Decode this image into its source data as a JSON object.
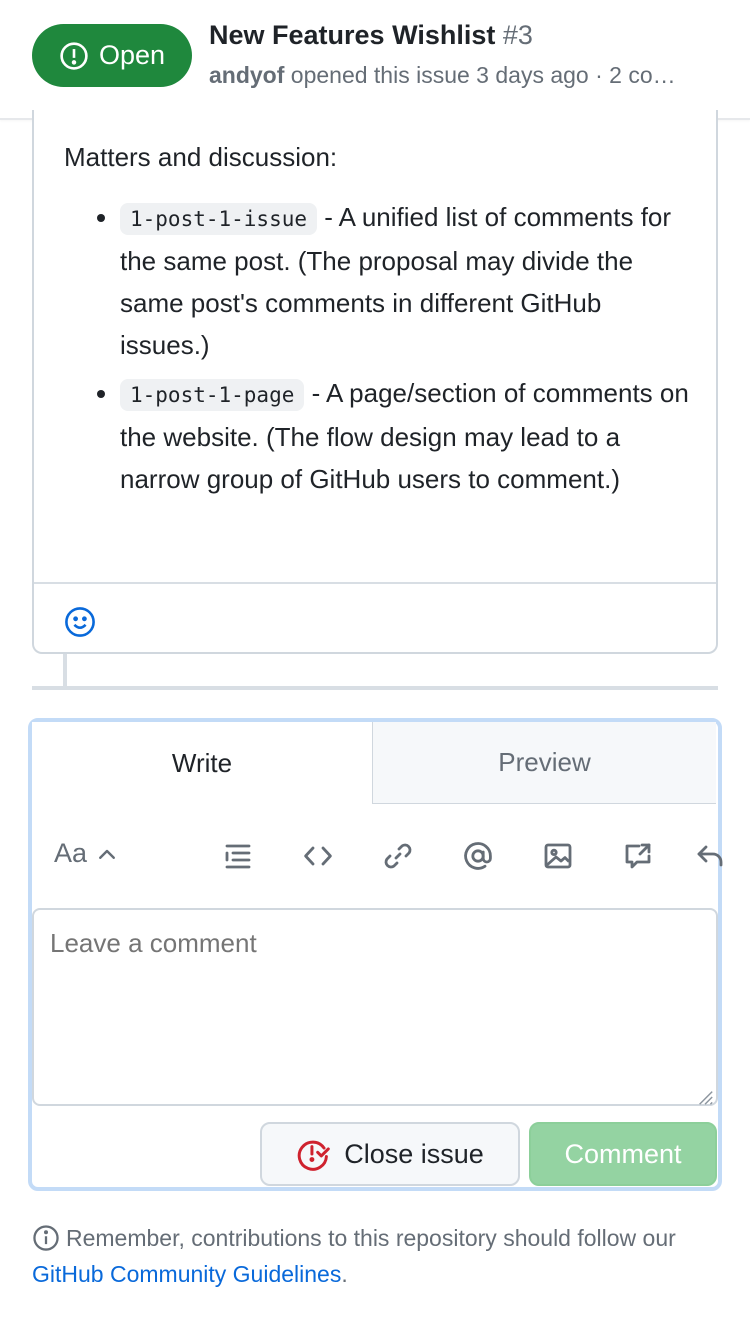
{
  "header": {
    "state_label": "Open",
    "title": "New Features Wishlist",
    "number": "#3",
    "author": "andyof",
    "meta_text": "opened this issue 3 days ago · 2 co…",
    "colors": {
      "open_green": "#1f883d"
    }
  },
  "comment": {
    "intro": "Matters and discussion:",
    "items": [
      {
        "code": "1-post-1-issue",
        "text": " - A unified list of comments for the same post. (The proposal may divide the same post's comments in different GitHub issues.)"
      },
      {
        "code": "1-post-1-page",
        "text": " - A page/section of comments on the website. (The flow design may lead to a narrow group of GitHub users to comment.)"
      }
    ],
    "reaction_icon": "smiley-icon"
  },
  "editor": {
    "tabs": [
      {
        "label": "Write"
      },
      {
        "label": "Preview"
      }
    ],
    "active_tab": "Write",
    "toolbar": {
      "text_size_label": "Aa",
      "icons": [
        "chevron-up-icon",
        "list-icon",
        "code-icon",
        "link-icon",
        "mention-icon",
        "image-icon",
        "cross-reference-icon",
        "reply-icon"
      ]
    },
    "textarea_placeholder": "Leave a comment",
    "textarea_value": "",
    "close_button_label": "Close issue",
    "comment_button_label": "Comment",
    "colors": {
      "comment_disabled": "#94d3a2",
      "close_icon": "#cf222e"
    }
  },
  "footer": {
    "note_text": "Remember, contributions to this repository should follow our",
    "link_text": "GitHub Community Guidelines",
    "trailing": "."
  }
}
